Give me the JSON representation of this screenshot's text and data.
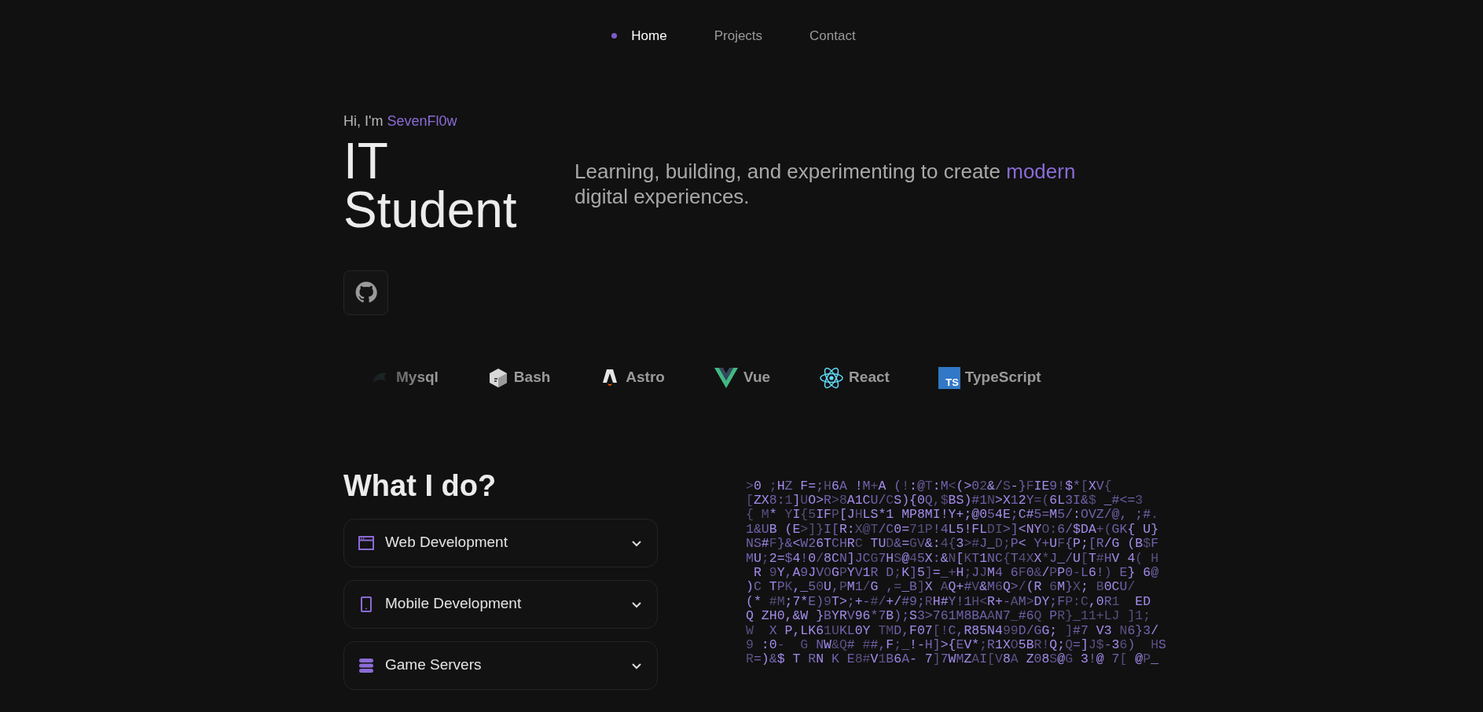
{
  "nav": [
    {
      "label": "Home",
      "selected": true
    },
    {
      "label": "Projects",
      "selected": false
    },
    {
      "label": "Contact",
      "selected": false
    }
  ],
  "hero": {
    "greeting": "Hi, I'm ",
    "name": "SevenFl0w",
    "title_lines": [
      "IT",
      "Student"
    ],
    "tagline": "Learning, building, and experimenting to create ",
    "tagline_highlight": "modern",
    "tagline_end": "digital experiences."
  },
  "tech": [
    {
      "kind": "mysql",
      "name": "Mysql"
    },
    {
      "kind": "bash",
      "name": "Bash"
    },
    {
      "kind": "astro",
      "name": "Astro"
    },
    {
      "kind": "vue",
      "name": "Vue"
    },
    {
      "kind": "react",
      "name": "React"
    },
    {
      "kind": "typescript",
      "name": "TypeScript",
      "badge": "TS"
    }
  ],
  "services": {
    "heading": "What I do?",
    "items": [
      {
        "kind": "browser",
        "title": "Web Development",
        "expanded": false
      },
      {
        "kind": "phone",
        "title": "Mobile Development",
        "expanded": false
      },
      {
        "kind": "server",
        "title": "Game Servers",
        "expanded": false
      }
    ]
  },
  "code_rain": [
    ">0 ;HZ F=;H6A !M+A (!:@T:M<(>02&/S-}FIE9!$*[XV{",
    "[ZX8:1]UO>R>8A1CU/CS){0Q,$BS)#1N>X12Y=(6L3I&$ _#<=3",
    "{ M* YI{5IFP[JHLS*1 MP8MI!Y+;@054E;C#5=M5/:OVZ/@, ;#.",
    "1&UB (E>]}I[R:X@T/C0=71P!4L5!FLDI>]<NYO:6/$DA+(GK{ U}",
    "NS#F}&<W26TCHRC TUD&=GV&:4{3>#J_D;P< Y+UF{P;[R/G (B$F",
    "MU;2=$4!0/8CN]JCG7HS@45X:&N[KT1NC{T4XX*J_/U[T#HV 4( H",
    " R 9Y,A9JVOGPYV1R D;K]5]=_+H;JJM4 6F0&/PP0-L6!) E} 6@",
    ")C TPK,_50U,PM1/G ,=_B]X AQ+#V&M6Q>/(R 6M}X; B0CU/",
    "(* #M;7*E)9T>;+-#/+/#9;RH#Y!1H<R+-AM>DY;FP:C,0R1  ED",
    "Q ZH0,&W }BYRV96*7B);S3>761M8BAAN7_#6Q PR}_11+LJ ]1;",
    "W  X P,LK61UKL0Y TMD,F07[!C,R85N499D/GG; ]#7 V3 N6}3/",
    "9 :0-  G NW&Q# ##,F;_!-H]>{EV*;R1XO5BR!Q;Q=]J$-36)  HS",
    "R=)&$ T RN K E8#V1B6A- 7]7WMZAI[V8A Z08S@G 3!@ 7[ @P_"
  ]
}
